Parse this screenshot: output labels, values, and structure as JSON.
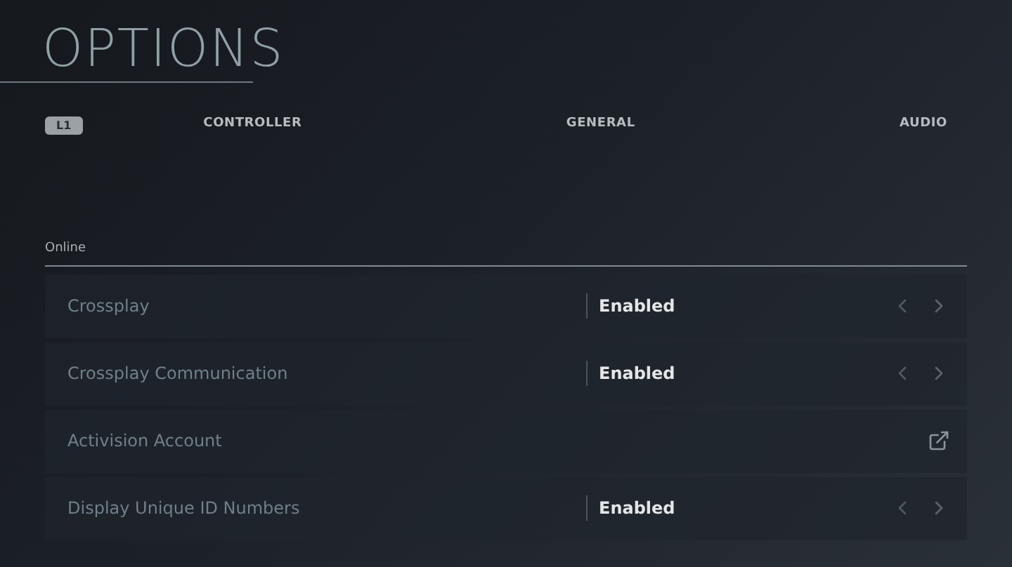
{
  "title": "OPTIONS",
  "tab_bar": {
    "key_hint": "L1",
    "tabs": [
      {
        "label": "CONTROLLER"
      },
      {
        "label": "GENERAL"
      },
      {
        "label": "AUDIO"
      }
    ]
  },
  "section": {
    "label": "Online",
    "rows": [
      {
        "kind": "choice",
        "label": "Crossplay",
        "value": "Enabled"
      },
      {
        "kind": "choice",
        "label": "Crossplay Communication",
        "value": "Enabled"
      },
      {
        "kind": "link",
        "label": "Activision Account"
      },
      {
        "kind": "choice",
        "label": "Display Unique ID Numbers",
        "value": "Enabled"
      }
    ]
  }
}
